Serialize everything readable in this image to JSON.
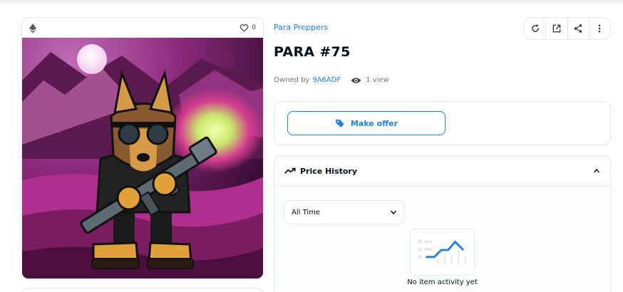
{
  "media": {
    "chain_icon": "ethereum-icon",
    "favorite_icon": "heart-icon",
    "favorite_count": "0",
    "artwork": "para-75-artwork"
  },
  "item": {
    "collection": "Para Preppers",
    "title": "PARA #75",
    "owned_by_label": "Owned by",
    "owner": "9A6ADF",
    "views": "1 view"
  },
  "toolbar": {
    "icons": [
      "refresh-icon",
      "external-link-icon",
      "share-icon",
      "more-vertical-icon"
    ]
  },
  "offer": {
    "button_label": "Make offer",
    "icon": "tag-icon"
  },
  "price_history": {
    "title": "Price History",
    "filter_value": "All Time",
    "empty_message": "No item activity yet"
  },
  "colors": {
    "accent": "#2081e2",
    "text": "#04111d",
    "muted": "#707a83",
    "border": "#e5e8eb"
  }
}
